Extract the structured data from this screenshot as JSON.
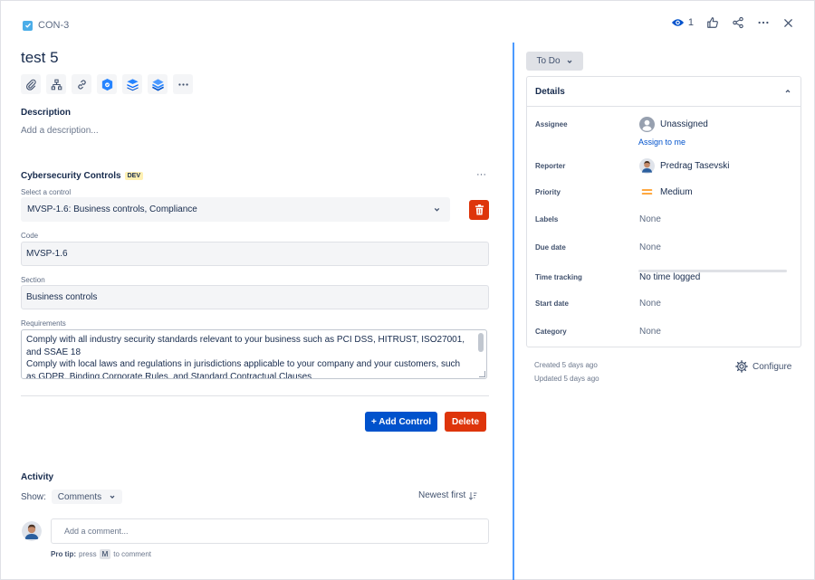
{
  "header": {
    "issue_key": "CON-3",
    "watch_count": "1"
  },
  "issue": {
    "title": "test 5"
  },
  "toolbar": {
    "icons": [
      "paperclip-icon",
      "child-issues-icon",
      "link-icon",
      "app-shield-icon",
      "app-stack-icon",
      "app-layers-icon",
      "more-icon"
    ]
  },
  "description": {
    "label": "Description",
    "placeholder": "Add a description..."
  },
  "cybersecurity": {
    "title": "Cybersecurity Controls",
    "badge": "DEV",
    "more": "···",
    "select_label": "Select a control",
    "selected_control": "MVSP-1.6: Business controls, Compliance",
    "code_label": "Code",
    "code_value": "MVSP-1.6",
    "section_label": "Section",
    "section_value": "Business controls",
    "requirements_label": "Requirements",
    "requirements_lines": [
      "Comply with all industry security standards relevant to your business such as PCI DSS, HITRUST, ISO27001,",
      "and SSAE 18",
      "Comply with local laws and regulations in jurisdictions applicable to your company and your customers, such",
      "as GDPR, Binding Corporate Rules, and Standard Contractual Clauses"
    ],
    "add_control_label": "+ Add Control",
    "delete_label": "Delete"
  },
  "activity": {
    "title": "Activity",
    "show_label": "Show:",
    "show_value": "Comments",
    "sort_label": "Newest first",
    "comment_placeholder": "Add a comment...",
    "pro_tip_bold": "Pro tip:",
    "pro_tip_pre": "press",
    "pro_tip_key": "M",
    "pro_tip_post": "to comment"
  },
  "status": {
    "label": "To Do"
  },
  "details": {
    "title": "Details",
    "rows": [
      {
        "label": "Assignee",
        "value": "Unassigned"
      },
      {
        "label": "Reporter",
        "value": "Predrag Tasevski"
      },
      {
        "label": "Priority",
        "value": "Medium"
      },
      {
        "label": "Labels",
        "value": "None"
      },
      {
        "label": "Due date",
        "value": "None"
      },
      {
        "label": "Time tracking",
        "value": "No time logged"
      },
      {
        "label": "Start date",
        "value": "None"
      },
      {
        "label": "Category",
        "value": "None"
      }
    ],
    "assign_to_me": "Assign to me"
  },
  "meta": {
    "created": "Created 5 days ago",
    "updated": "Updated 5 days ago",
    "configure": "Configure"
  },
  "colors": {
    "accent": "#0052cc",
    "danger": "#de350b",
    "divider": "#4c9aff",
    "priority_medium": "#ff8b00"
  }
}
